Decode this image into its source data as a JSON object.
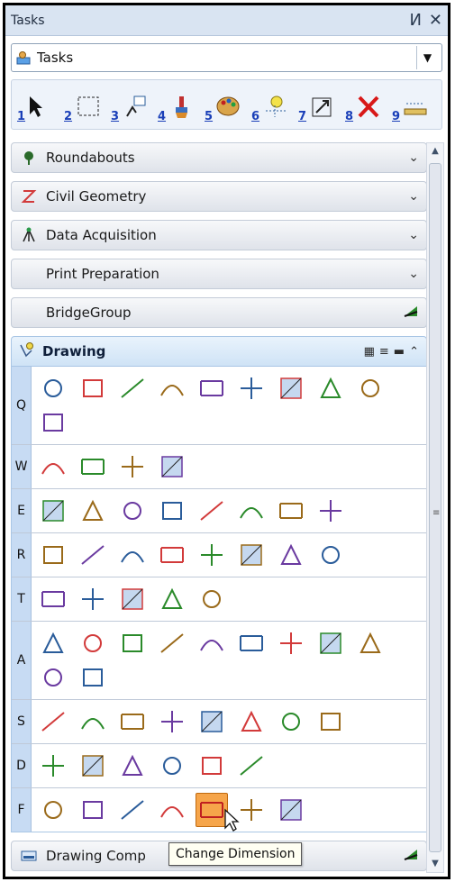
{
  "window": {
    "title": "Tasks"
  },
  "title_controls": {
    "pin": "И",
    "close": "✕"
  },
  "dropdown": {
    "value": "Tasks"
  },
  "toolbar": {
    "numbers": [
      "1",
      "2",
      "3",
      "4",
      "5",
      "6",
      "7",
      "8",
      "9"
    ]
  },
  "groups": [
    {
      "label": "Roundabouts",
      "icon": "roundabout-icon"
    },
    {
      "label": "Civil Geometry",
      "icon": "civil-geometry-icon"
    },
    {
      "label": "Data Acquisition",
      "icon": "data-acquisition-icon"
    },
    {
      "label": "Print Preparation",
      "icon": ""
    },
    {
      "label": "BridgeGroup",
      "icon": ""
    }
  ],
  "drawing": {
    "label": "Drawing",
    "rows": [
      {
        "key": "Q",
        "count": 10
      },
      {
        "key": "W",
        "count": 4
      },
      {
        "key": "E",
        "count": 8
      },
      {
        "key": "R",
        "count": 8
      },
      {
        "key": "T",
        "count": 5
      },
      {
        "key": "A",
        "count": 11
      },
      {
        "key": "S",
        "count": 8
      },
      {
        "key": "D",
        "count": 6
      },
      {
        "key": "F",
        "count": 7
      }
    ]
  },
  "bottom_group": {
    "label": "Drawing Comp"
  },
  "tooltip": {
    "text": "Change Dimension"
  },
  "colors": {
    "accent": "#f6a54a",
    "header": "#cfe3f6",
    "row_key": "#c7dbf3"
  }
}
